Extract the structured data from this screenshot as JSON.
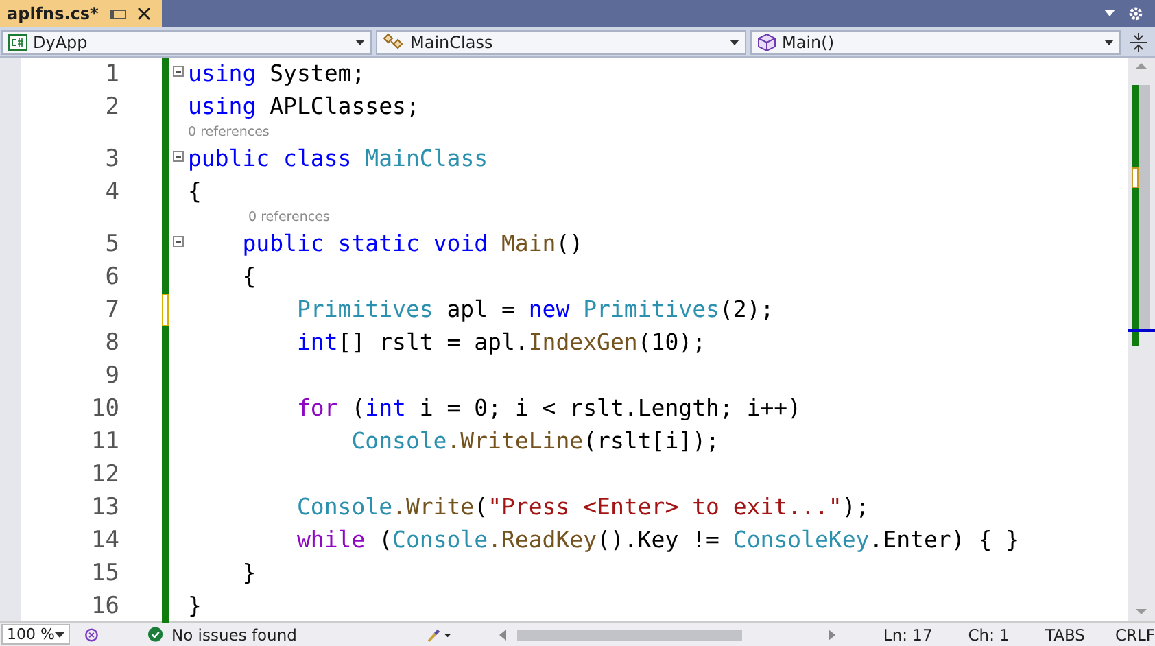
{
  "tab": {
    "title": "aplfns.cs*",
    "pinned": false
  },
  "nav": [
    {
      "kind": "project",
      "label": "DyApp"
    },
    {
      "kind": "class",
      "label": "MainClass"
    },
    {
      "kind": "method",
      "label": "Main()"
    }
  ],
  "rows": [
    {
      "kind": "code",
      "number": "1",
      "fold": true,
      "modified": false,
      "tokens": [
        {
          "kind": "keyword",
          "s": "using"
        },
        {
          "kind": "plain",
          "s": " System;"
        }
      ]
    },
    {
      "kind": "code",
      "number": "2",
      "fold": false,
      "modified": false,
      "tokens": [
        {
          "kind": "keyword",
          "s": "using"
        },
        {
          "kind": "plain",
          "s": " APLClasses;"
        }
      ]
    },
    {
      "kind": "code",
      "number": "3",
      "codelens": "0 references",
      "fold": true,
      "modified": false,
      "tokens": [
        {
          "kind": "keyword",
          "s": "public"
        },
        {
          "kind": "keyword",
          "s": " class"
        },
        {
          "kind": "type",
          "s": " MainClass"
        }
      ]
    },
    {
      "kind": "code",
      "number": "4",
      "fold": false,
      "modified": false,
      "tokens": [
        {
          "kind": "plain",
          "s": "{"
        }
      ]
    },
    {
      "kind": "code",
      "number": "5",
      "codelens": "0 references",
      "fold": true,
      "modified": false,
      "tokens": [
        {
          "kind": "keyword",
          "s": "    public"
        },
        {
          "kind": "keyword",
          "s": " static"
        },
        {
          "kind": "keyword",
          "s": " void"
        },
        {
          "kind": "method",
          "s": " Main"
        },
        {
          "kind": "plain",
          "s": "()"
        }
      ]
    },
    {
      "kind": "code",
      "number": "6",
      "fold": false,
      "modified": false,
      "tokens": [
        {
          "kind": "plain",
          "s": "    {"
        }
      ]
    },
    {
      "kind": "code",
      "number": "7",
      "fold": false,
      "modified": true,
      "tokens": [
        {
          "kind": "type",
          "s": "        Primitives"
        },
        {
          "kind": "plain",
          "s": " apl = "
        },
        {
          "kind": "keyword",
          "s": "new"
        },
        {
          "kind": "type",
          "s": " Primitives"
        },
        {
          "kind": "plain",
          "s": "(2);"
        }
      ]
    },
    {
      "kind": "code",
      "number": "8",
      "fold": false,
      "modified": false,
      "tokens": [
        {
          "kind": "keyword",
          "s": "        int"
        },
        {
          "kind": "plain",
          "s": "[] rslt = apl."
        },
        {
          "kind": "method",
          "s": "IndexGen"
        },
        {
          "kind": "plain",
          "s": "(10);"
        }
      ]
    },
    {
      "kind": "code",
      "number": "9",
      "fold": false,
      "modified": false,
      "tokens": []
    },
    {
      "kind": "code",
      "number": "10",
      "fold": false,
      "modified": false,
      "tokens": [
        {
          "kind": "control",
          "s": "        for"
        },
        {
          "kind": "plain",
          "s": " ("
        },
        {
          "kind": "keyword",
          "s": "int"
        },
        {
          "kind": "plain",
          "s": " i = 0; i < rslt.Length; i++)"
        }
      ]
    },
    {
      "kind": "code",
      "number": "11",
      "fold": false,
      "modified": false,
      "tokens": [
        {
          "kind": "type",
          "s": "            Console"
        },
        {
          "kind": "method",
          "s": ".WriteLine"
        },
        {
          "kind": "plain",
          "s": "(rslt[i]);"
        }
      ]
    },
    {
      "kind": "code",
      "number": "12",
      "fold": false,
      "modified": false,
      "tokens": []
    },
    {
      "kind": "code",
      "number": "13",
      "fold": false,
      "modified": false,
      "tokens": [
        {
          "kind": "type",
          "s": "        Console"
        },
        {
          "kind": "method",
          "s": ".Write"
        },
        {
          "kind": "plain",
          "s": "("
        },
        {
          "kind": "string",
          "s": "\"Press <Enter> to exit...\""
        },
        {
          "kind": "plain",
          "s": ");"
        }
      ]
    },
    {
      "kind": "code",
      "number": "14",
      "fold": false,
      "modified": false,
      "tokens": [
        {
          "kind": "control",
          "s": "        while"
        },
        {
          "kind": "plain",
          "s": " ("
        },
        {
          "kind": "type",
          "s": "Console"
        },
        {
          "kind": "method",
          "s": ".ReadKey"
        },
        {
          "kind": "plain",
          "s": "().Key != "
        },
        {
          "kind": "type",
          "s": "ConsoleKey"
        },
        {
          "kind": "plain",
          "s": ".Enter) { }"
        }
      ]
    },
    {
      "kind": "code",
      "number": "15",
      "fold": false,
      "modified": false,
      "tokens": [
        {
          "kind": "plain",
          "s": "    }"
        }
      ]
    },
    {
      "kind": "code",
      "number": "16",
      "fold": false,
      "modified": false,
      "tokens": [
        {
          "kind": "plain",
          "s": "}"
        }
      ]
    }
  ],
  "status": {
    "zoom": "100 %",
    "issues": "No issues found",
    "line": "Ln: 17",
    "column": "Ch: 1",
    "indent": "TABS",
    "eol": "CRLF"
  }
}
